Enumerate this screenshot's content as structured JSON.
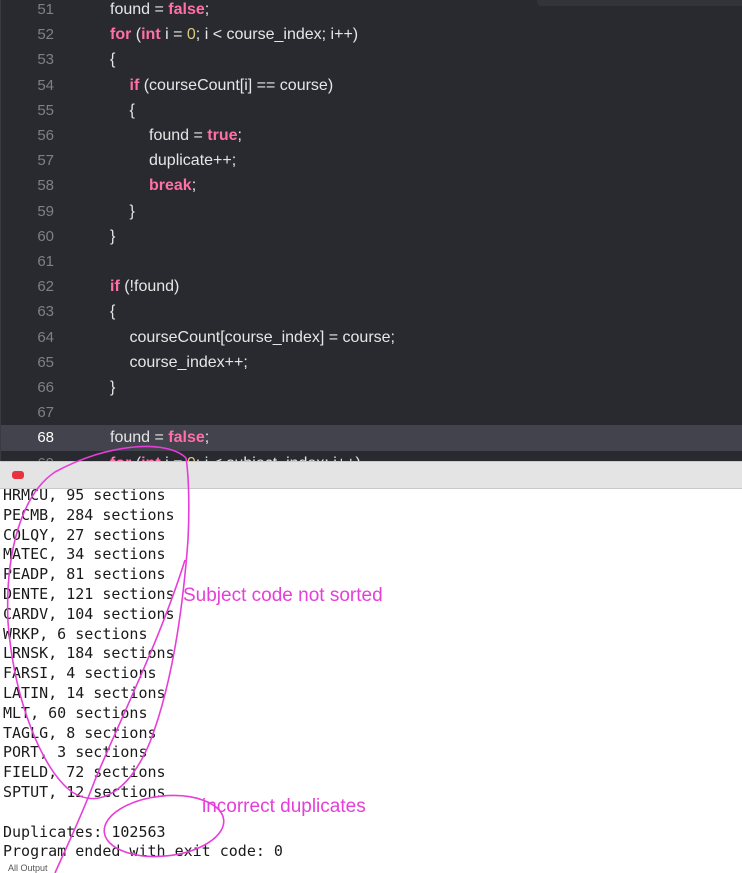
{
  "editor": {
    "lines": [
      {
        "num": "51",
        "indent": 1,
        "tokens": [
          {
            "t": "found = "
          },
          {
            "t": "false",
            "c": "kw"
          },
          {
            "t": ";"
          }
        ]
      },
      {
        "num": "52",
        "indent": 1,
        "tokens": [
          {
            "t": "for",
            "c": "kw"
          },
          {
            "t": " ("
          },
          {
            "t": "int",
            "c": "kw"
          },
          {
            "t": " i = "
          },
          {
            "t": "0",
            "c": "num"
          },
          {
            "t": "; i < course_index; i++)"
          }
        ]
      },
      {
        "num": "53",
        "indent": 1,
        "tokens": [
          {
            "t": "{"
          }
        ]
      },
      {
        "num": "54",
        "indent": 2,
        "tokens": [
          {
            "t": "if",
            "c": "kw"
          },
          {
            "t": " (courseCount[i] == course)"
          }
        ]
      },
      {
        "num": "55",
        "indent": 2,
        "tokens": [
          {
            "t": "{"
          }
        ]
      },
      {
        "num": "56",
        "indent": 3,
        "tokens": [
          {
            "t": "found = "
          },
          {
            "t": "true",
            "c": "kw"
          },
          {
            "t": ";"
          }
        ]
      },
      {
        "num": "57",
        "indent": 3,
        "tokens": [
          {
            "t": "duplicate++;"
          }
        ]
      },
      {
        "num": "58",
        "indent": 3,
        "tokens": [
          {
            "t": "break",
            "c": "kw"
          },
          {
            "t": ";"
          }
        ]
      },
      {
        "num": "59",
        "indent": 2,
        "tokens": [
          {
            "t": "}"
          }
        ]
      },
      {
        "num": "60",
        "indent": 1,
        "tokens": [
          {
            "t": "}"
          }
        ]
      },
      {
        "num": "61",
        "indent": 1,
        "tokens": []
      },
      {
        "num": "62",
        "indent": 1,
        "tokens": [
          {
            "t": "if",
            "c": "kw"
          },
          {
            "t": " (!found)"
          }
        ]
      },
      {
        "num": "63",
        "indent": 1,
        "tokens": [
          {
            "t": "{"
          }
        ]
      },
      {
        "num": "64",
        "indent": 2,
        "tokens": [
          {
            "t": "courseCount[course_index] = course;"
          }
        ]
      },
      {
        "num": "65",
        "indent": 2,
        "tokens": [
          {
            "t": "course_index++;"
          }
        ]
      },
      {
        "num": "66",
        "indent": 1,
        "tokens": [
          {
            "t": "}"
          }
        ]
      },
      {
        "num": "67",
        "indent": 1,
        "tokens": []
      },
      {
        "num": "68",
        "indent": 1,
        "current": true,
        "tokens": [
          {
            "t": "found = "
          },
          {
            "t": "false",
            "c": "kw"
          },
          {
            "t": ";"
          }
        ]
      },
      {
        "num": "69",
        "indent": 1,
        "tokens": [
          {
            "t": "for",
            "c": "kw"
          },
          {
            "t": " ("
          },
          {
            "t": "int",
            "c": "kw"
          },
          {
            "t": " i = "
          },
          {
            "t": "0",
            "c": "num"
          },
          {
            "t": "; i < subject_index; i++)"
          }
        ]
      }
    ]
  },
  "console": {
    "lines": [
      "HRMCU, 95 sections",
      "PECMB, 284 sections",
      "COLQY, 27 sections",
      "MATEC, 34 sections",
      "PEADP, 81 sections",
      "DENTE, 121 sections",
      "CARDV, 104 sections",
      "WRKP, 6 sections",
      "LRNSK, 184 sections",
      "FARSI, 4 sections",
      "LATIN, 14 sections",
      "MLT, 60 sections",
      "TAGLG, 8 sections",
      "PORT, 3 sections",
      "FIELD, 72 sections",
      "SPTUT, 12 sections",
      "",
      "Duplicates: 102563",
      "Program ended with exit code: 0"
    ],
    "footer_tab": "All Output"
  },
  "annotations": {
    "not_sorted": "Subject code not sorted",
    "duplicates": "incorrect duplicates",
    "color": "#e63ed8"
  },
  "colors": {
    "editor_bg": "#292a30",
    "keyword": "#ff6fa8",
    "number": "#d8c97c",
    "current_line": "#42434d",
    "breakpoint": "#e8323e"
  }
}
